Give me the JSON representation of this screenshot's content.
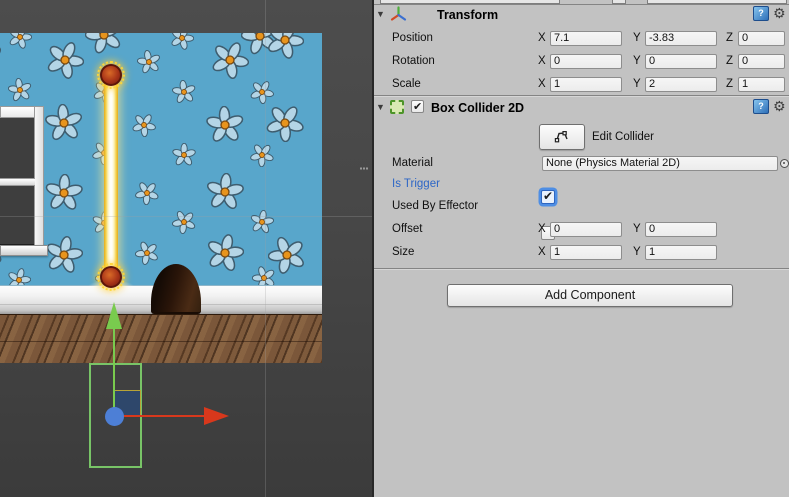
{
  "inspector": {
    "axes": {
      "x": "X",
      "y": "Y",
      "z": "Z"
    },
    "transform": {
      "title": "Transform",
      "rows": [
        {
          "label": "Position",
          "x": "7.1",
          "y": "-3.83",
          "z": "0"
        },
        {
          "label": "Rotation",
          "x": "0",
          "y": "0",
          "z": "0"
        },
        {
          "label": "Scale",
          "x": "1",
          "y": "2",
          "z": "1"
        }
      ]
    },
    "box_collider_2d": {
      "title": "Box Collider 2D",
      "enabled": true,
      "edit_collider": {
        "label": "Edit Collider"
      },
      "material": {
        "label": "Material",
        "value": "None (Physics Material 2D)"
      },
      "is_trigger": {
        "label": "Is Trigger",
        "checked": true
      },
      "used_by_effector": {
        "label": "Used By Effector",
        "checked": false
      },
      "offset": {
        "label": "Offset",
        "x": "0",
        "y": "0"
      },
      "size": {
        "label": "Size",
        "x": "1",
        "y": "1"
      }
    },
    "add_component": {
      "label": "Add Component"
    },
    "help_glyph": "?",
    "gear_glyph": "⚙",
    "foldout_glyph": "▼"
  },
  "colors": {
    "inspector_bg": "#c2c2c2",
    "modified_property_blue": "#2d66c6",
    "wall_blue": "#58a6cb",
    "gizmo_green": "#79cb4e",
    "gizmo_red": "#d8381c",
    "gizmo_blue": "#4d7fd6",
    "beam_yellow": "#f5d24d"
  }
}
